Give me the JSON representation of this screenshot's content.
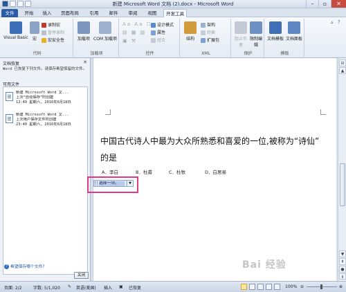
{
  "window": {
    "title": "新建 Microsoft Word 文档 (2).docx - Microsoft Word"
  },
  "tabs": [
    "文件",
    "开始",
    "插入",
    "页面布局",
    "引用",
    "邮件",
    "审阅",
    "视图",
    "开发工具"
  ],
  "ribbon": {
    "code": {
      "label": "代码",
      "visual_basic": "Visual Basic",
      "macros": "宏",
      "record_macro": "录制宏",
      "pause_recording": "暂停录制",
      "macro_security": "宏安全性"
    },
    "addins": {
      "label": "加载项",
      "addins": "加载项",
      "com_addins": "COM 加载项"
    },
    "controls": {
      "label": "控件",
      "design_mode": "设计模式",
      "properties": "属性",
      "group": "组合"
    },
    "xml": {
      "label": "XML",
      "structure": "结构",
      "schema": "架构",
      "transform": "转换",
      "expansion_packs": "扩展包"
    },
    "protect": {
      "label": "保护",
      "block_authors": "阻止作者",
      "restrict_editing": "限制编辑"
    },
    "templates": {
      "label": "模板",
      "document_template": "文档模板",
      "document_panel": "文档面板"
    }
  },
  "recovery_pane": {
    "title": "文档恢复",
    "description": "Word 已恢复下列文件。请保存希望保留的文件。",
    "available_label": "可用文件",
    "files": [
      {
        "name": "新建 Microsoft Word 文...",
        "status": "上次“自动保存”时创建",
        "time": "12:49 星期六, 2016年6月18日"
      },
      {
        "name": "新建 Microsoft Word 文...",
        "status": "上次用户保存文件时创建",
        "time": "23:40 星期六, 2016年6月18日"
      }
    ],
    "which_file_link": "希望保存哪个文件?",
    "close_button": "关闭"
  },
  "document": {
    "question_line1": "中国古代诗人中最为大众所熟悉和喜爱的一位,被称为“诗仙”",
    "question_line2": "的是",
    "options": [
      "A．李白",
      "B．杜甫",
      "C．杜牧",
      "D．白居易"
    ],
    "dropdown_value": "选择一项。"
  },
  "status_bar": {
    "page": "页面: 2/2",
    "words": "字数: 5/1,020",
    "language": "英语(美国)",
    "insert_mode": "插入",
    "recovered": "已恢复",
    "zoom": "100%"
  },
  "watermark": "Bai 经验",
  "colors": {
    "file_tab": "#2a5ca8",
    "highlight_frame": "#e03a86",
    "dropdown_fill": "#b6cbe8"
  }
}
